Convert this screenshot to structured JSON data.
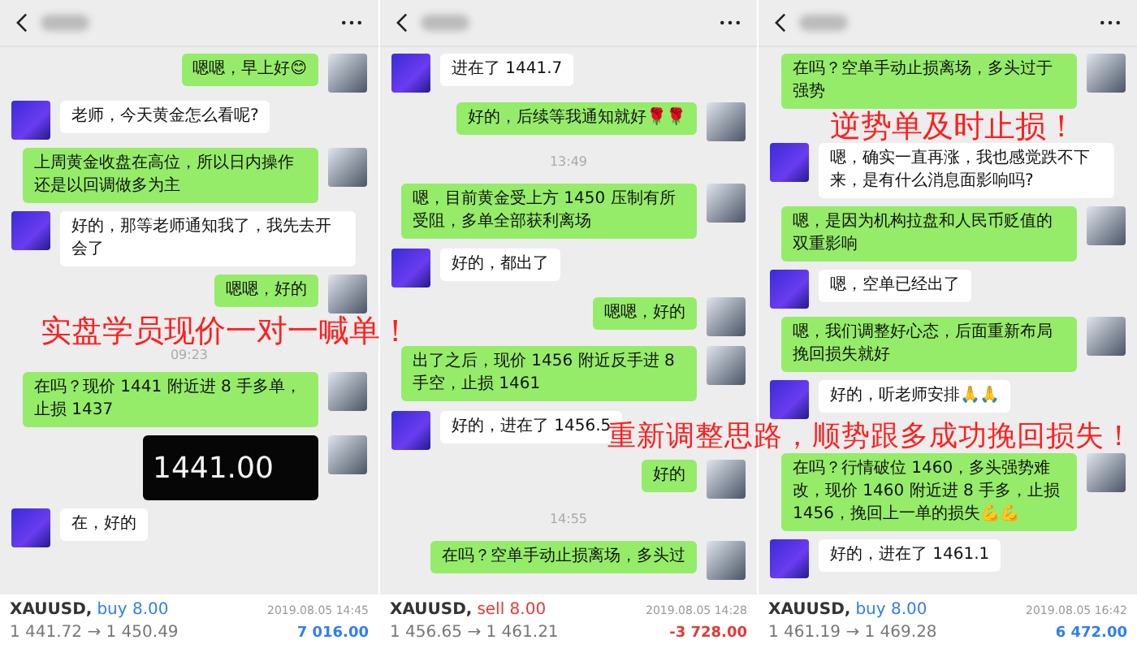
{
  "panels": [
    {
      "messages": [
        {
          "kind": "out",
          "text": "嗯嗯，早上好😊"
        },
        {
          "kind": "in",
          "text": "老师，今天黄金怎么看呢?"
        },
        {
          "kind": "out",
          "text": "上周黄金收盘在高位，所以日内操作还是以回调做多为主"
        },
        {
          "kind": "in",
          "text": "好的，那等老师通知我了，我先去开会了"
        },
        {
          "kind": "out",
          "text": "嗯嗯，好的"
        },
        {
          "kind": "caption",
          "text": "实盘学员现价一对一喊单！"
        },
        {
          "kind": "time",
          "text": "09:23"
        },
        {
          "kind": "out",
          "text": "在吗？现价 1441 附近进 8 手多单，止损 1437"
        },
        {
          "kind": "image",
          "text": "1441.00"
        },
        {
          "kind": "in",
          "text": "在，好的"
        }
      ],
      "trade": {
        "symbol": "XAUUSD,",
        "order": "buy 8.00",
        "sell": false,
        "date": "2019.08.05 14:45",
        "prices": "1 441.72 → 1 450.49",
        "profit": "7 016.00",
        "loss": false
      }
    },
    {
      "messages": [
        {
          "kind": "in",
          "text": "进在了 1441.7"
        },
        {
          "kind": "out",
          "text": "好的，后续等我通知就好🌹🌹"
        },
        {
          "kind": "time",
          "text": "13:49"
        },
        {
          "kind": "out",
          "text": "嗯，目前黄金受上方 1450 压制有所受阻，多单全部获利离场"
        },
        {
          "kind": "in",
          "text": "好的，都出了"
        },
        {
          "kind": "out",
          "text": "嗯嗯，好的"
        },
        {
          "kind": "out",
          "text": "出了之后，现价 1456 附近反手进 8 手空，止损 1461"
        },
        {
          "kind": "in",
          "text": "好的，进在了 1456.5"
        },
        {
          "kind": "out",
          "text": "好的"
        },
        {
          "kind": "time",
          "text": "14:55"
        },
        {
          "kind": "out",
          "text": "在吗？空单手动止损离场，多头过"
        }
      ],
      "trade": {
        "symbol": "XAUUSD,",
        "order": "sell 8.00",
        "sell": true,
        "date": "2019.08.05 14:28",
        "prices": "1 456.65 → 1 461.21",
        "profit": "-3 728.00",
        "loss": true
      }
    },
    {
      "messages": [
        {
          "kind": "out",
          "text": "在吗？空单手动止损离场，多头过于强势"
        },
        {
          "kind": "caption",
          "text": "逆势单及时止损！"
        },
        {
          "kind": "in",
          "text": "嗯，确实一直再涨，我也感觉跌不下来，是有什么消息面影响吗?"
        },
        {
          "kind": "out",
          "text": "嗯，是因为机构拉盘和人民币贬值的双重影响"
        },
        {
          "kind": "in",
          "text": "嗯，空单已经出了"
        },
        {
          "kind": "out",
          "text": "嗯，我们调整好心态，后面重新布局挽回损失就好"
        },
        {
          "kind": "in",
          "text": "好的，听老师安排🙏🙏"
        },
        {
          "kind": "caption",
          "text": "重新调整思路，顺势跟多成功挽回损失！"
        },
        {
          "kind": "out",
          "text": "在吗？行情破位 1460，多头强势难改，现价 1460 附近进 8 手多，止损 1456，挽回上一单的损失💪💪"
        },
        {
          "kind": "in",
          "text": "好的，进在了 1461.1"
        }
      ],
      "trade": {
        "symbol": "XAUUSD,",
        "order": "buy 8.00",
        "sell": false,
        "date": "2019.08.05 16:42",
        "prices": "1 461.19 → 1 469.28",
        "profit": "6 472.00",
        "loss": false
      }
    }
  ]
}
